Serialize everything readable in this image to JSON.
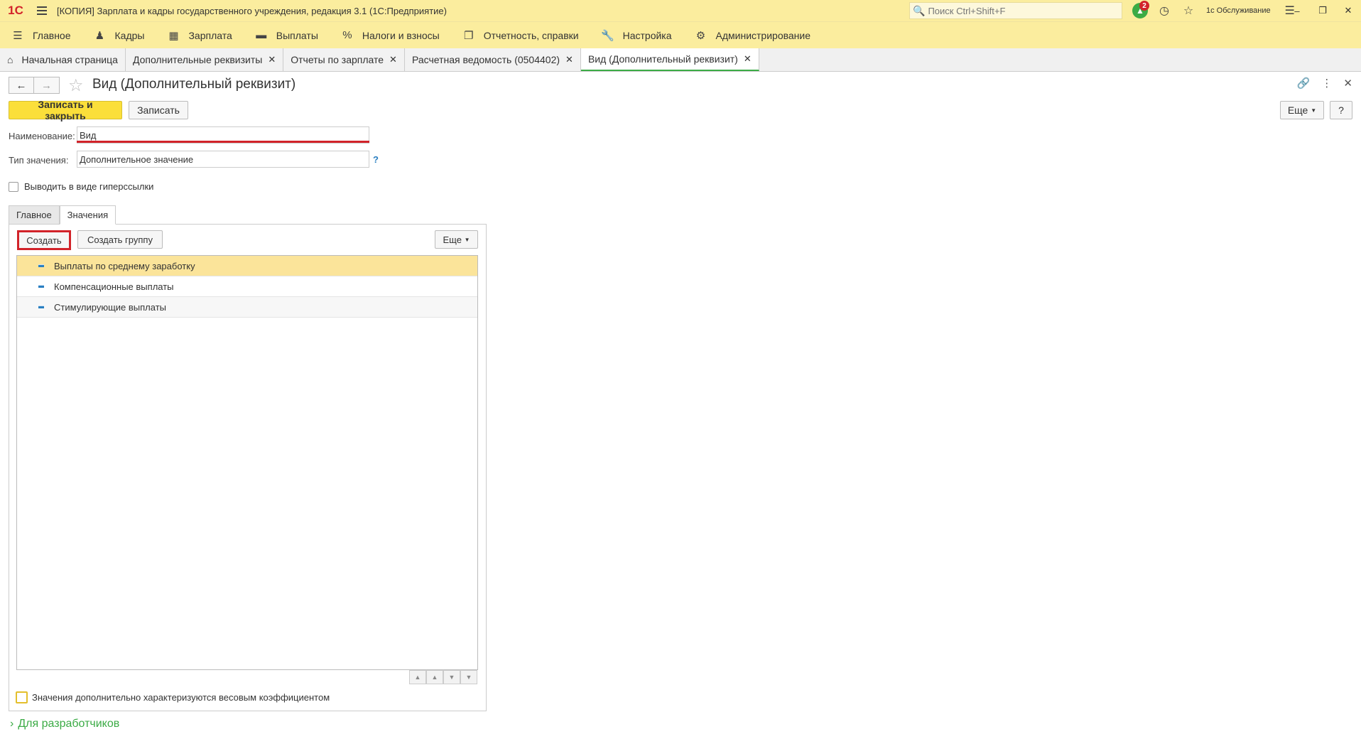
{
  "titlebar": {
    "logo": "1С",
    "title": "[КОПИЯ] Зарплата и кадры государственного учреждения, редакция 3.1  (1С:Предприятие)",
    "search_placeholder": "Поиск Ctrl+Shift+F",
    "notifications_count": "2",
    "user": "1с Обслуживание"
  },
  "menu": [
    {
      "label": "Главное",
      "icon": "menu-icon"
    },
    {
      "label": "Кадры",
      "icon": "people-icon"
    },
    {
      "label": "Зарплата",
      "icon": "calculator-icon"
    },
    {
      "label": "Выплаты",
      "icon": "wallet-icon"
    },
    {
      "label": "Налоги и взносы",
      "icon": "percent-icon"
    },
    {
      "label": "Отчетность, справки",
      "icon": "documents-icon"
    },
    {
      "label": "Настройка",
      "icon": "wrench-icon"
    },
    {
      "label": "Администрирование",
      "icon": "gear-icon"
    }
  ],
  "tabs": [
    {
      "label": "Начальная страница"
    },
    {
      "label": "Дополнительные реквизиты"
    },
    {
      "label": "Отчеты по зарплате"
    },
    {
      "label": "Расчетная ведомость (0504402)"
    },
    {
      "label": "Вид (Дополнительный реквизит)"
    }
  ],
  "form": {
    "title": "Вид (Дополнительный реквизит)",
    "save_close_label": "Записать и закрыть",
    "save_label": "Записать",
    "more_label": "Еще",
    "help_label": "?",
    "name_label": "Наименование:",
    "name_value": "Вид",
    "type_label": "Тип значения:",
    "type_value": "Дополнительное значение",
    "type_help": "?",
    "hyperlink_label": "Выводить в виде гиперссылки",
    "inner_tabs": [
      "Главное",
      "Значения"
    ],
    "create_label": "Создать",
    "create_group_label": "Создать группу",
    "inner_more_label": "Еще",
    "values": [
      "Выплаты по среднему заработку",
      "Компенсационные выплаты",
      "Стимулирующие выплаты"
    ],
    "weight_label": "Значения дополнительно характеризуются весовым коэффициентом",
    "dev_link": "Для разработчиков"
  }
}
